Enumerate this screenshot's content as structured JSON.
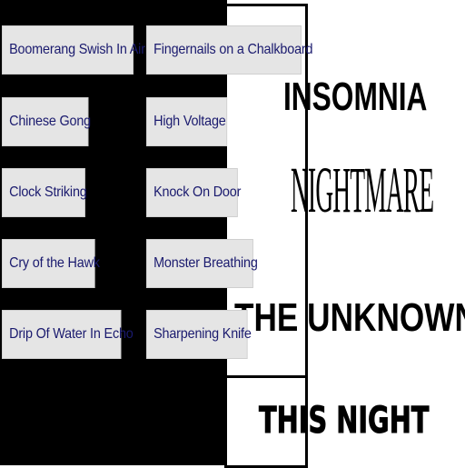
{
  "sounds_left": [
    "Boomerang Swish In Air",
    "Chinese Gong",
    "Clock Striking",
    "Cry of the Hawk",
    "Drip Of Water In Echo"
  ],
  "sounds_right": [
    "Fingernails on a Chalkboard",
    "High Voltage",
    "Knock On Door",
    "Monster Breathing",
    "Sharpening Knife"
  ],
  "titles": {
    "t1": "INSOMNIA",
    "t2": "NIGHTMARE",
    "t3": "THE UNKNOWN",
    "t4": "THIS NIGHT"
  },
  "colors": {
    "background_left": "#000000",
    "button": "#e5e5e5",
    "button_text": "#1a1a6e"
  }
}
